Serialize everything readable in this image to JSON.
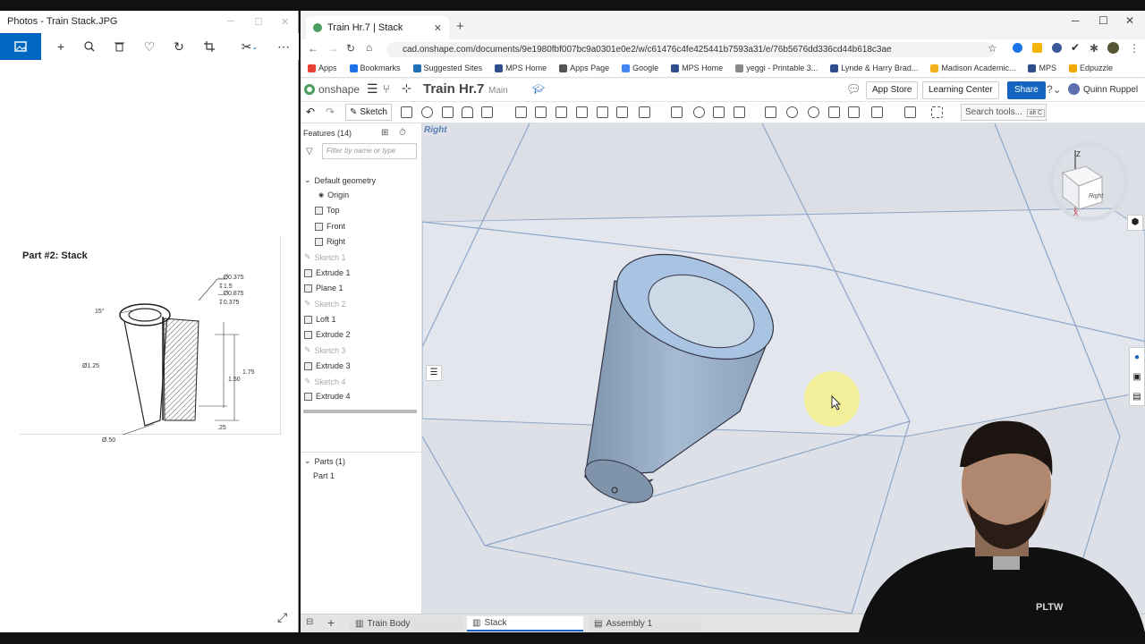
{
  "photos": {
    "title": "Photos - Train Stack.JPG",
    "drawing": {
      "title": "Part #2: Stack",
      "dims": {
        "cb1": "⌴Ø0.375",
        "d1": "↧1.5",
        "cb2": "⌴Ø0.875",
        "d2": "↧0.375",
        "angle": "15°",
        "dia_big": "Ø1.25",
        "h1": "1.50",
        "h2": "1.75",
        "bottom": ".25",
        "dia_small": "Ø.50"
      }
    }
  },
  "chrome": {
    "tab_title": "Train Hr.7 | Stack",
    "url": "cad.onshape.com/documents/9e1980fbf007bc9a0301e0e2/w/c61476c4fe425441b7593a31/e/76b5676dd336cd44b618c3ae",
    "bookmarks": [
      {
        "label": "Apps",
        "color": "#e94235"
      },
      {
        "label": "Bookmarks",
        "color": "#1a73e8"
      },
      {
        "label": "Suggested Sites",
        "color": "#1d6fb8"
      },
      {
        "label": "MPS Home",
        "color": "#2f4d8c"
      },
      {
        "label": "Apps Page",
        "color": "#555555"
      },
      {
        "label": "Google",
        "color": "#4285f4"
      },
      {
        "label": "MPS Home",
        "color": "#2f4d8c"
      },
      {
        "label": "yeggi - Printable 3...",
        "color": "#888888"
      },
      {
        "label": "Lynde & Harry Brad...",
        "color": "#2f4d8c"
      },
      {
        "label": "Madison Academic...",
        "color": "#f2b01e"
      },
      {
        "label": "MPS",
        "color": "#2f4d8c"
      },
      {
        "label": "Edpuzzle",
        "color": "#f2a900"
      }
    ]
  },
  "onshape": {
    "logo": "onshape",
    "doc_title": "Train Hr.7",
    "branch": "Main",
    "app_store": "App Store",
    "learning": "Learning Center",
    "share": "Share",
    "user": "Quinn Ruppel",
    "sketch": "Sketch",
    "search": "Search tools...",
    "search_hint": "alt C",
    "features_header": "Features (14)",
    "filter_placeholder": "Filter by name or type",
    "features": [
      {
        "label": "Default geometry",
        "dim": false
      },
      {
        "label": "Origin",
        "dim": false
      },
      {
        "label": "Top",
        "dim": false
      },
      {
        "label": "Front",
        "dim": false
      },
      {
        "label": "Right",
        "dim": false
      },
      {
        "label": "Sketch 1",
        "dim": true
      },
      {
        "label": "Extrude 1",
        "dim": false
      },
      {
        "label": "Plane 1",
        "dim": false
      },
      {
        "label": "Sketch 2",
        "dim": true
      },
      {
        "label": "Loft 1",
        "dim": false
      },
      {
        "label": "Extrude 2",
        "dim": false
      },
      {
        "label": "Sketch 3",
        "dim": true
      },
      {
        "label": "Extrude 3",
        "dim": false
      },
      {
        "label": "Sketch 4",
        "dim": true
      },
      {
        "label": "Extrude 4",
        "dim": false
      }
    ],
    "parts_header": "Parts (1)",
    "part": "Part 1",
    "plane_label": "Right",
    "viewcube": {
      "z": "Z",
      "x": "X",
      "face": "Right"
    },
    "tabs": [
      "Train Body",
      "Stack",
      "Assembly 1"
    ],
    "accent": "#1565c0"
  },
  "watermark": "PLTW"
}
